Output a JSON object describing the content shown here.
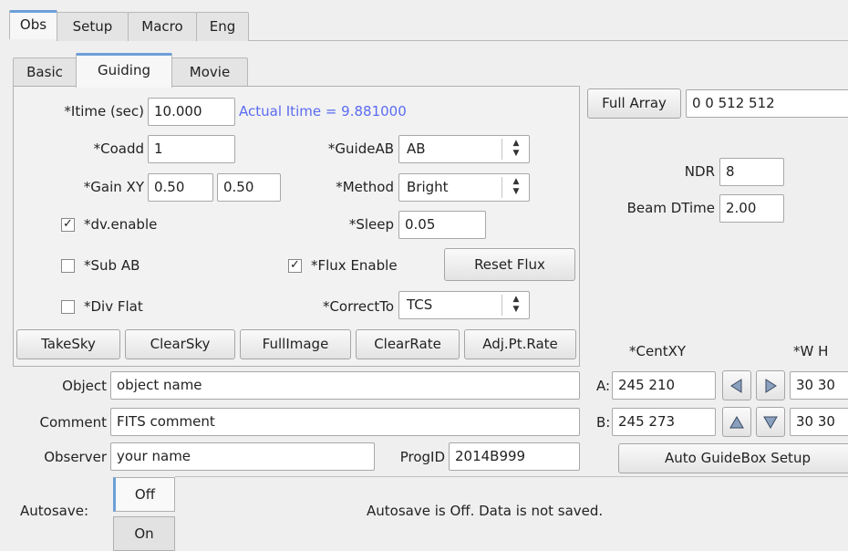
{
  "top_tabs": [
    "Obs",
    "Setup",
    "Macro",
    "Eng"
  ],
  "sub_tabs": [
    "Basic",
    "Guiding",
    "Movie"
  ],
  "guiding": {
    "itime_label": "*Itime (sec)",
    "itime_value": "10.000",
    "actual_itime": "Actual Itime = 9.881000",
    "coadd_label": "*Coadd",
    "coadd_value": "1",
    "guideab_label": "*GuideAB",
    "guideab_value": "AB",
    "gain_label": "*Gain XY",
    "gain_x": "0.50",
    "gain_y": "0.50",
    "method_label": "*Method",
    "method_value": "Bright",
    "dv_enable_label": "*dv.enable",
    "dv_enable_checked": true,
    "sleep_label": "*Sleep",
    "sleep_value": "0.05",
    "sub_ab_label": "*Sub AB",
    "sub_ab_checked": false,
    "flux_enable_label": "*Flux Enable",
    "flux_enable_checked": true,
    "reset_flux_label": "Reset Flux",
    "div_flat_label": "*Div Flat",
    "div_flat_checked": false,
    "correctto_label": "*CorrectTo",
    "correctto_value": "TCS",
    "buttons": [
      "TakeSky",
      "ClearSky",
      "FullImage",
      "ClearRate",
      "Adj.Pt.Rate"
    ]
  },
  "right": {
    "full_array_label": "Full Array",
    "full_array_value": "0 0 512 512",
    "ndr_label": "NDR",
    "ndr_value": "8",
    "beam_dtime_label": "Beam DTime",
    "beam_dtime_value": "2.00",
    "centxy_label": "*CentXY",
    "wh_label": "*W H",
    "a_label": "A:",
    "a_cent": "245 210",
    "a_wh": "30 30",
    "b_label": "B:",
    "b_cent": "245 273",
    "b_wh": "30 30",
    "auto_guidebox_label": "Auto GuideBox Setup"
  },
  "info": {
    "object_label": "Object",
    "object_value": "object name",
    "comment_label": "Comment",
    "comment_value": "FITS comment",
    "observer_label": "Observer",
    "observer_value": "your name",
    "progid_label": "ProgID",
    "progid_value": "2014B999"
  },
  "autosave": {
    "label": "Autosave:",
    "options": [
      "Off",
      "On"
    ],
    "selected": "Off",
    "status": "Autosave is Off. Data is not saved."
  },
  "colors": {
    "actual_itime": "#5a6cf0",
    "tab_accent": "#6d9fd8"
  }
}
